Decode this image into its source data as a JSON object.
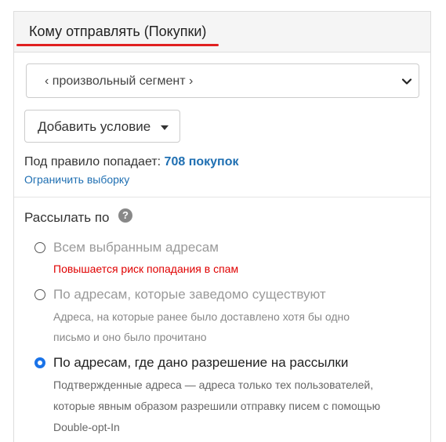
{
  "panel": {
    "title": "Кому отправлять (Покупки)",
    "accent_color": "#e02020"
  },
  "segment_select": {
    "value": "‹ произвольный сегмент ›",
    "icon": "chevron-down-icon"
  },
  "add_condition": {
    "label": "Добавить условие"
  },
  "rule": {
    "prefix": "Под правило попадает:",
    "count": "708 покупок",
    "limit_link": "Ограничить выборку"
  },
  "send_by": {
    "label": "Рассылать по",
    "help_icon": "?",
    "options": [
      {
        "label": "Всем выбранным адресам",
        "note": "Повышается риск попадания в спам",
        "checked": false,
        "disabled": true
      },
      {
        "label": "По адресам, которые заведомо существуют",
        "note_line1": "Адреса, на которые ранее было доставлено хотя бы одно",
        "note_line2": "письмо и оно было прочитано",
        "checked": false,
        "disabled": true
      },
      {
        "label": "По адресам, где дано разрешение на рассылки",
        "note_line1": "Подтвержденные адреса — адреса только тех пользователей,",
        "note_line2": "которые явным образом разрешили отправку писем с помощью",
        "note_line3": "Double-opt-In",
        "checked": true,
        "disabled": false
      }
    ]
  },
  "colors": {
    "link": "#1f6fb2",
    "warning": "#e00000",
    "radio_checked": "#1a73e8"
  }
}
